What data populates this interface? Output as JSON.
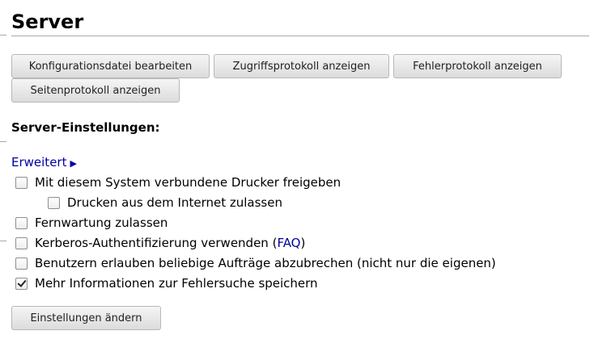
{
  "page": {
    "title": "Server"
  },
  "toolbar": {
    "edit_config_label": "Konfigurationsdatei bearbeiten",
    "access_log_label": "Zugriffsprotokoll anzeigen",
    "error_log_label": "Fehlerprotokoll anzeigen",
    "page_log_label": "Seitenprotokoll anzeigen"
  },
  "settings": {
    "heading": "Server-Einstellungen:",
    "advanced_label": "Erweitert",
    "advanced_arrow": "▶",
    "options": {
      "share_printers": {
        "label": "Mit diesem System verbundene Drucker freigeben",
        "checked": false
      },
      "internet_printing": {
        "label": "Drucken aus dem Internet zulassen",
        "checked": false
      },
      "remote_admin": {
        "label": "Fernwartung zulassen",
        "checked": false
      },
      "kerberos": {
        "label_before": "Kerberos-Authentifizierung verwenden (",
        "link": "FAQ",
        "label_after": ")",
        "checked": false
      },
      "cancel_any": {
        "label": "Benutzern erlauben beliebige Aufträge abzubrechen (nicht nur die eigenen)",
        "checked": false
      },
      "debug_logging": {
        "label": "Mehr Informationen zur Fehlersuche speichern",
        "checked": true
      }
    },
    "submit_label": "Einstellungen ändern"
  },
  "colors": {
    "link": "#0000a0",
    "rule": "#a8a8a8",
    "button_border": "#b8b8b8"
  }
}
